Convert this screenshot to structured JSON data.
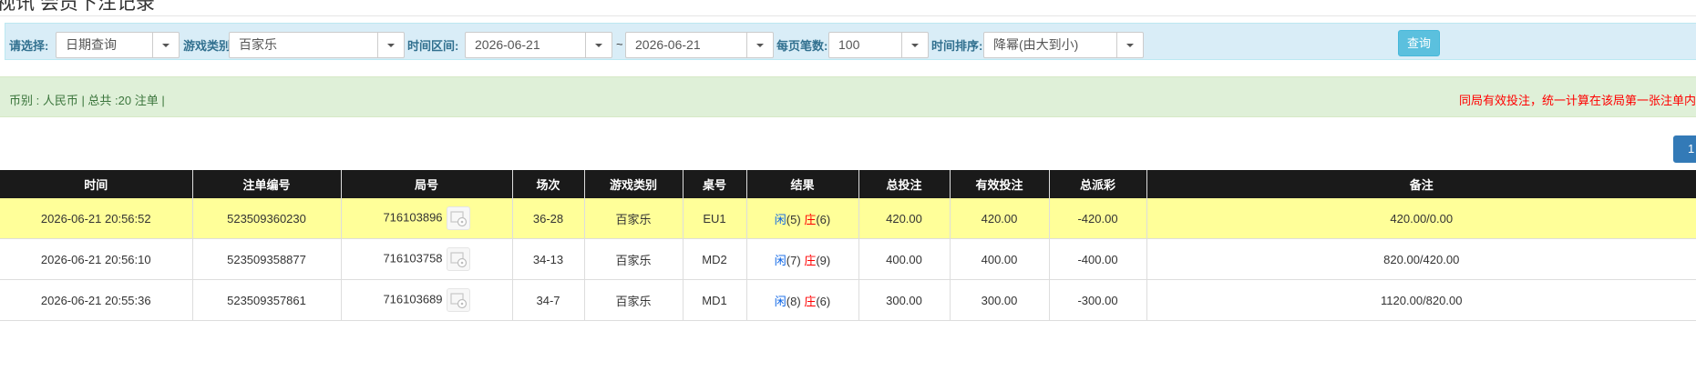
{
  "page": {
    "title": "视讯 会员下注记录"
  },
  "filters": {
    "select_label": "请选择:",
    "select_value": "日期查询",
    "game_type_label": "游戏类别",
    "game_type_value": "百家乐",
    "time_range_label": "时间区间:",
    "date_from": "2026-06-21",
    "tilde": "~",
    "date_to": "2026-06-21",
    "page_size_label": "每页笔数:",
    "page_size_value": "100",
    "sort_label": "时间排序:",
    "sort_value": "降幂(由大到小)",
    "query_button": "查询"
  },
  "info": {
    "summary": "币别 : 人民币 | 总共 :20 注单 |",
    "notice": "同局有效投注，统一计算在该局第一张注单内"
  },
  "pagination": {
    "current": "1"
  },
  "table": {
    "headers": [
      "时间",
      "注单编号",
      "局号",
      "场次",
      "游戏类别",
      "桌号",
      "结果",
      "总投注",
      "有效投注",
      "总派彩",
      "备注"
    ],
    "rows": [
      {
        "time": "2026-06-21 20:56:52",
        "bet_no": "523509360230",
        "round_no": "716103896",
        "session": "36-28",
        "game": "百家乐",
        "table_no": "EU1",
        "result_player": "闲",
        "result_player_pts": "(5)",
        "result_banker": "庄",
        "result_banker_pts": "(6)",
        "total_bet": "420.00",
        "valid_bet": "420.00",
        "payout": "-420.00",
        "note": "420.00/0.00",
        "highlight": true
      },
      {
        "time": "2026-06-21 20:56:10",
        "bet_no": "523509358877",
        "round_no": "716103758",
        "session": "34-13",
        "game": "百家乐",
        "table_no": "MD2",
        "result_player": "闲",
        "result_player_pts": "(7)",
        "result_banker": "庄",
        "result_banker_pts": "(9)",
        "total_bet": "400.00",
        "valid_bet": "400.00",
        "payout": "-400.00",
        "note": "820.00/420.00",
        "highlight": false
      },
      {
        "time": "2026-06-21 20:55:36",
        "bet_no": "523509357861",
        "round_no": "716103689",
        "session": "34-7",
        "game": "百家乐",
        "table_no": "MD1",
        "result_player": "闲",
        "result_player_pts": "(8)",
        "result_banker": "庄",
        "result_banker_pts": "(6)",
        "total_bet": "300.00",
        "valid_bet": "300.00",
        "payout": "-300.00",
        "note": "1120.00/820.00",
        "highlight": false
      }
    ]
  },
  "colors": {
    "accent": "#5bc0de",
    "header_bg": "#1a1a1a",
    "highlight_row": "#ffff99",
    "positive_blue": "#0b64e6",
    "negative_red": "#ff0000"
  }
}
